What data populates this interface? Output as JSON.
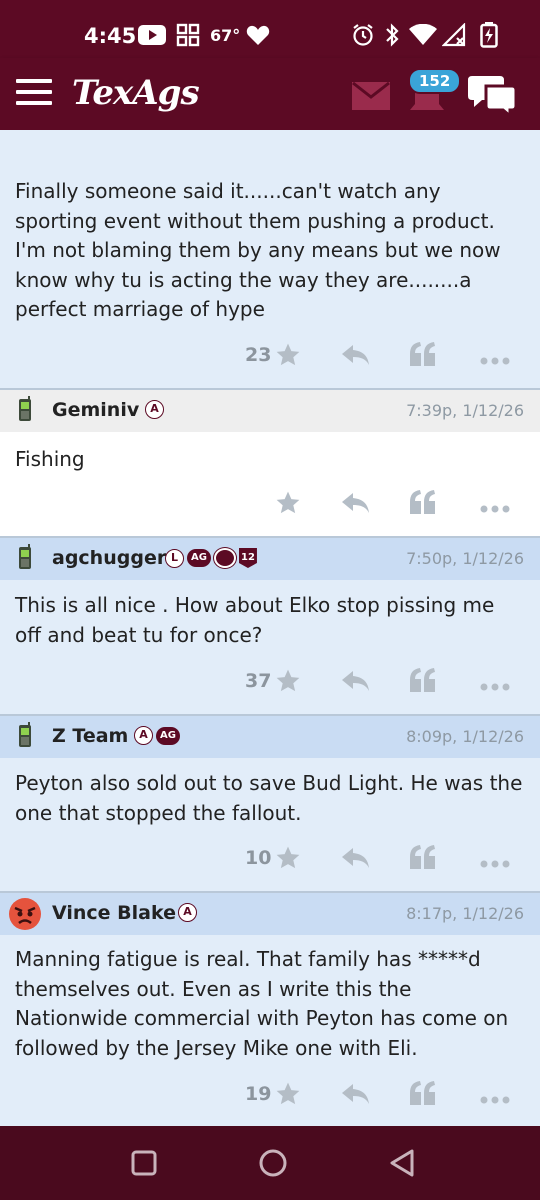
{
  "status_bar": {
    "time": "4:45",
    "temperature": "67°",
    "icons": [
      "youtube-icon",
      "grid-app-icon",
      "heart-icon",
      "alarm-icon",
      "bluetooth-icon",
      "wifi-icon",
      "signal-icon",
      "battery-icon"
    ]
  },
  "header": {
    "logo_text": "TexAgs",
    "notification_count": "152",
    "icons": [
      "hamburger-menu-icon",
      "mail-icon",
      "bell-icon",
      "chat-icon"
    ],
    "colors": {
      "brand": "#5c0a24",
      "badge": "#3aa4d8"
    }
  },
  "posts": [
    {
      "text": "Finally someone said it......can't watch any sporting event without them pushing a product. I'm not blaming them by any means but we now know why tu is acting the way they are........a perfect marriage of hype",
      "likes": "23"
    },
    {
      "username": "Geminiv",
      "timestamp": "7:39p, 1/12/26",
      "badges": [
        "A"
      ],
      "text": "Fishing",
      "likes": ""
    },
    {
      "username": "agchugger",
      "timestamp": "7:50p, 1/12/26",
      "badges": [
        "L",
        "AG",
        "12"
      ],
      "text": "This is all nice . How about Elko stop pissing me off and beat tu for once?",
      "likes": "37"
    },
    {
      "username": "Z Team",
      "timestamp": "8:09p, 1/12/26",
      "badges": [
        "A",
        "AG"
      ],
      "text": "Peyton also sold out to save Bud Light. He was the one that stopped the fallout.",
      "likes": "10"
    },
    {
      "username": "Vince Blake",
      "timestamp": "8:17p, 1/12/26",
      "badges": [
        "A"
      ],
      "text": "Manning fatigue is real. That family has *****d themselves out. Even as I write this the Nationwide commercial with Peyton has come on followed by the Jersey Mike one with Eli.",
      "likes": "19"
    }
  ],
  "navbar": {
    "icons": [
      "recents-square-icon",
      "home-circle-icon",
      "back-triangle-icon"
    ]
  }
}
